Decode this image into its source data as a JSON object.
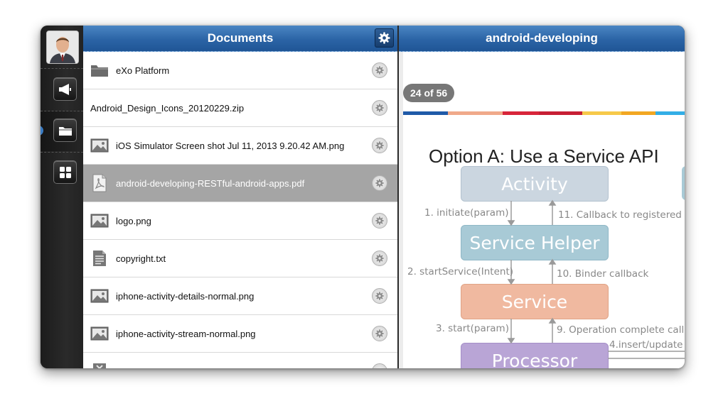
{
  "documents_panel": {
    "title": "Documents",
    "items": [
      {
        "name": "eXo Platform",
        "icon": "folder-icon"
      },
      {
        "name": "Android_Design_Icons_20120229.zip",
        "icon": ""
      },
      {
        "name": "iOS Simulator Screen shot Jul 11, 2013 9.20.42 AM.png",
        "icon": "image-icon"
      },
      {
        "name": "android-developing-RESTful-android-apps.pdf",
        "icon": "pdf-icon",
        "selected": true
      },
      {
        "name": "logo.png",
        "icon": "image-icon"
      },
      {
        "name": "copyright.txt",
        "icon": "text-file-icon"
      },
      {
        "name": "iphone-activity-details-normal.png",
        "icon": "image-icon"
      },
      {
        "name": "iphone-activity-stream-normal.png",
        "icon": "image-icon"
      }
    ]
  },
  "viewer": {
    "title": "android-developing",
    "page_counter": "24 of 56",
    "slide": {
      "title": "Option A: Use a Service API",
      "boxes": [
        "Activity",
        "Service Helper",
        "Service",
        "Processor"
      ],
      "labels": [
        "1. initiate(param)",
        "11. Callback to registered a",
        "2. startService(Intent)",
        "10. Binder callback",
        "3. start(param)",
        "9. Operation complete callb",
        "4.insert/update"
      ]
    }
  },
  "colors": {
    "header_blue": "#2b64a6",
    "selected_row": "#a5a5a5",
    "activity_box": "#cbd6e0",
    "service_helper_box": "#a8cad6",
    "service_box": "#f0b9a0",
    "processor_box": "#b9a5d6",
    "stripe": [
      "#1f5aa8",
      "#f0a98a",
      "#d8253a",
      "#d8253a",
      "#f6c94a",
      "#f2a722",
      "#33aee6"
    ]
  }
}
